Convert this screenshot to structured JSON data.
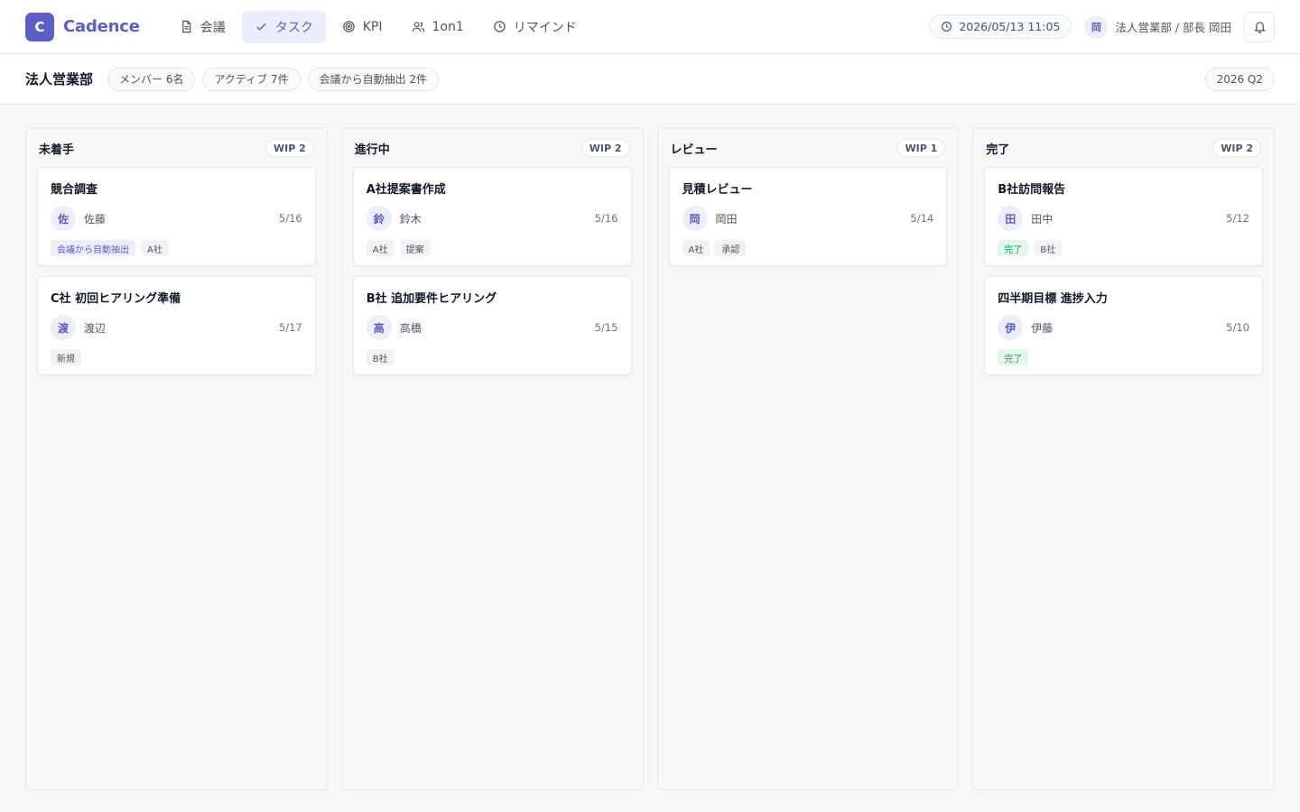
{
  "brand": {
    "logo_letter": "C",
    "name": "Cadence"
  },
  "nav": [
    {
      "label": "会議",
      "icon": "document-icon",
      "active": false
    },
    {
      "label": "タスク",
      "icon": "check-icon",
      "active": true
    },
    {
      "label": "KPI",
      "icon": "target-icon",
      "active": false
    },
    {
      "label": "1on1",
      "icon": "users-icon",
      "active": false
    },
    {
      "label": "リマインド",
      "icon": "clock-icon",
      "active": false
    }
  ],
  "header": {
    "datetime": "2026/05/13 11:05",
    "user_initial": "岡",
    "user_label": "法人営業部 / 部長 岡田"
  },
  "subheader": {
    "team": "法人営業部",
    "chips": [
      "メンバー 6名",
      "アクティブ 7件",
      "会議から自動抽出 2件"
    ],
    "quarter": "2026 Q2"
  },
  "columns": [
    {
      "title": "未着手",
      "wip": "WIP 2",
      "cards": [
        {
          "title": "競合調査",
          "initial": "佐",
          "assignee": "佐藤",
          "due": "5/16",
          "tags": [
            {
              "label": "会議から自動抽出",
              "kind": "auto"
            },
            {
              "label": "A社",
              "kind": "default"
            }
          ]
        },
        {
          "title": "C社 初回ヒアリング準備",
          "initial": "渡",
          "assignee": "渡辺",
          "due": "5/17",
          "tags": [
            {
              "label": "新規",
              "kind": "default"
            }
          ]
        }
      ]
    },
    {
      "title": "進行中",
      "wip": "WIP 2",
      "cards": [
        {
          "title": "A社提案書作成",
          "initial": "鈴",
          "assignee": "鈴木",
          "due": "5/16",
          "tags": [
            {
              "label": "A社",
              "kind": "default"
            },
            {
              "label": "提案",
              "kind": "default"
            }
          ]
        },
        {
          "title": "B社 追加要件ヒアリング",
          "initial": "高",
          "assignee": "高橋",
          "due": "5/15",
          "tags": [
            {
              "label": "B社",
              "kind": "default"
            }
          ]
        }
      ]
    },
    {
      "title": "レビュー",
      "wip": "WIP 1",
      "cards": [
        {
          "title": "見積レビュー",
          "initial": "岡",
          "assignee": "岡田",
          "due": "5/14",
          "tags": [
            {
              "label": "A社",
              "kind": "default"
            },
            {
              "label": "承認",
              "kind": "default"
            }
          ]
        }
      ]
    },
    {
      "title": "完了",
      "wip": "WIP 2",
      "cards": [
        {
          "title": "B社訪問報告",
          "initial": "田",
          "assignee": "田中",
          "due": "5/12",
          "tags": [
            {
              "label": "完了",
              "kind": "done"
            },
            {
              "label": "B社",
              "kind": "default"
            }
          ]
        },
        {
          "title": "四半期目標 進捗入力",
          "initial": "伊",
          "assignee": "伊藤",
          "due": "5/10",
          "tags": [
            {
              "label": "完了",
              "kind": "done"
            }
          ]
        }
      ]
    }
  ]
}
